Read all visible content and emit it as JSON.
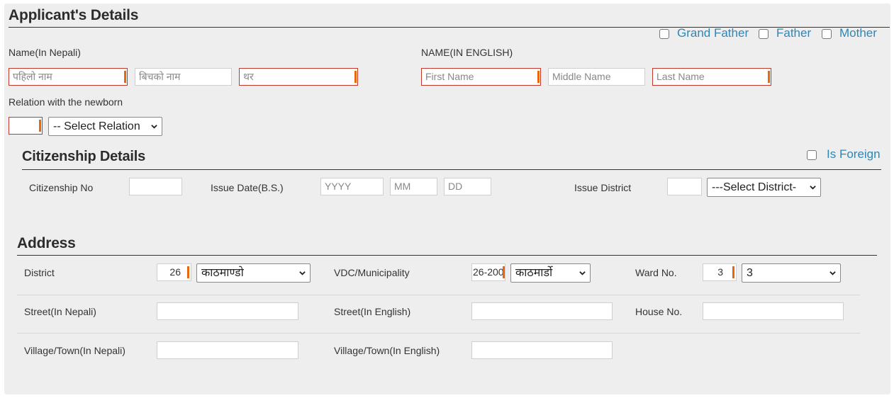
{
  "applicant": {
    "title": "Applicant's Details",
    "relation_checkboxes": [
      {
        "label": "Grand Father",
        "checked": false
      },
      {
        "label": "Father",
        "checked": false
      },
      {
        "label": "Mother",
        "checked": false
      }
    ],
    "name_nepali": {
      "label": "Name(In Nepali)",
      "first_placeholder": "पहिलो नाम",
      "middle_placeholder": "बिचको नाम",
      "last_placeholder": "थर"
    },
    "name_english": {
      "label": "NAME(IN ENGLISH)",
      "first_placeholder": "First Name",
      "middle_placeholder": "Middle Name",
      "last_placeholder": "Last Name"
    },
    "relation": {
      "label": "Relation with the newborn",
      "code_value": "",
      "select_value": "-- Select Relation"
    }
  },
  "citizenship": {
    "title": "Citizenship Details",
    "is_foreign_label": "Is Foreign",
    "is_foreign_checked": false,
    "citizenship_no_label": "Citizenship No",
    "citizenship_no_value": "",
    "issue_date_label": "Issue Date(B.S.)",
    "year_placeholder": "YYYY",
    "month_placeholder": "MM",
    "day_placeholder": "DD",
    "issue_district_label": "Issue District",
    "issue_district_code": "",
    "issue_district_select": "---Select District-"
  },
  "address": {
    "title": "Address",
    "district_label": "District",
    "district_code": "26",
    "district_select": "काठमाण्डो",
    "vdc_label": "VDC/Municipality",
    "vdc_code": "26-200",
    "vdc_select": "काठमार्डो",
    "ward_label": "Ward No.",
    "ward_code": "3",
    "ward_select": "3",
    "street_np_label": "Street(In Nepali)",
    "street_np_value": "",
    "street_en_label": "Street(In English)",
    "street_en_value": "",
    "house_no_label": "House No.",
    "house_no_value": "",
    "village_np_label": "Village/Town(In Nepali)",
    "village_np_value": "",
    "village_en_label": "Village/Town(In English)",
    "village_en_value": ""
  }
}
